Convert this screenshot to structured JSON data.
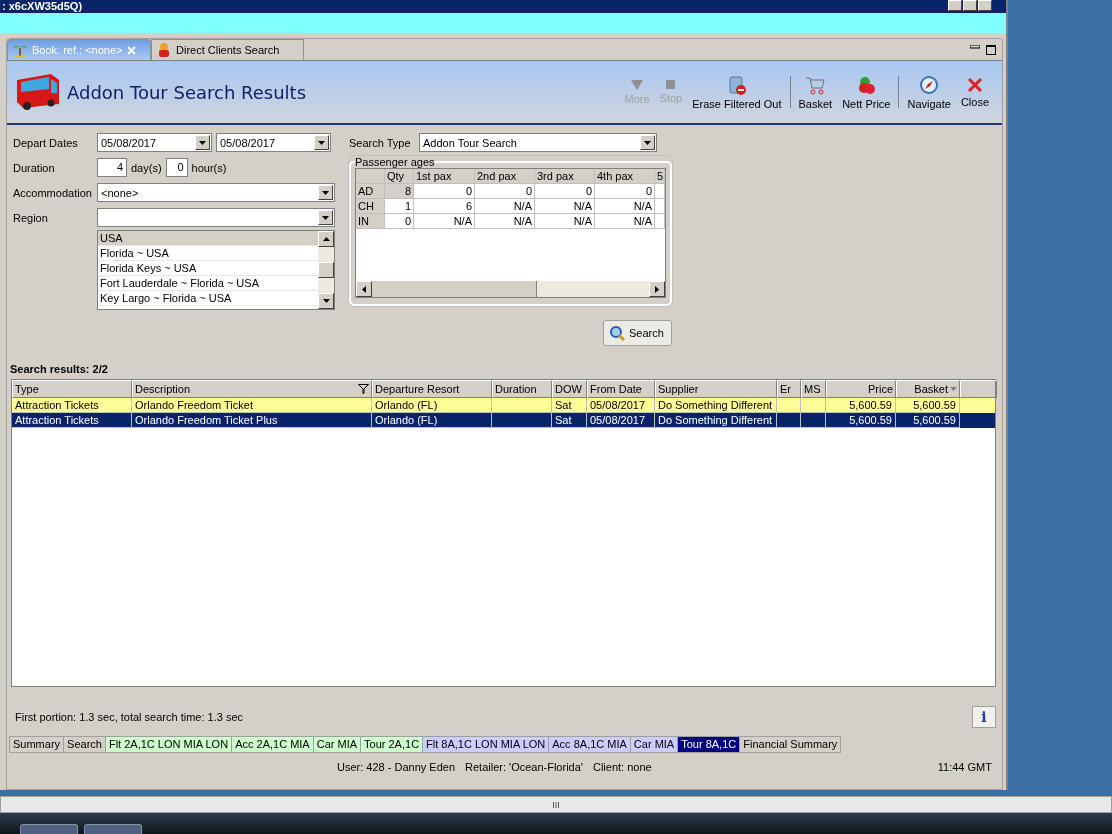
{
  "window": {
    "title": ": x6cXW35d5Q)"
  },
  "doc_tabs": [
    {
      "label": "Book. ref.: <none>",
      "selected": true,
      "closable": true
    },
    {
      "label": "Direct Clients Search",
      "selected": false,
      "closable": false
    }
  ],
  "header": {
    "title": "Addon Tour Search Results"
  },
  "toolbar": [
    {
      "label": "More",
      "disabled": true,
      "kind": "more",
      "separated": false
    },
    {
      "label": "Stop",
      "disabled": true,
      "kind": "stop",
      "separated": false
    },
    {
      "label": "Erase Filtered Out",
      "disabled": false,
      "kind": "erase",
      "separated": false
    },
    {
      "label": "Basket",
      "disabled": false,
      "kind": "basket",
      "separated": true
    },
    {
      "label": "Nett Price",
      "disabled": false,
      "kind": "price",
      "separated": false
    },
    {
      "label": "Navigate",
      "disabled": false,
      "kind": "navigate",
      "separated": true
    },
    {
      "label": "Close",
      "disabled": false,
      "kind": "close",
      "separated": false
    }
  ],
  "form": {
    "depart_dates_label": "Depart Dates",
    "depart_from": "05/08/2017",
    "depart_to": "05/08/2017",
    "duration_label": "Duration",
    "days": "4",
    "days_unit": "day(s)",
    "hours": "0",
    "hours_unit": "hour(s)",
    "accommodation_label": "Accommodation",
    "accommodation": "<none>",
    "region_label": "Region",
    "region_list": [
      {
        "label": "USA",
        "selected": true
      },
      {
        "label": "Florida ~ USA",
        "selected": false
      },
      {
        "label": "Florida Keys ~ USA",
        "selected": false
      },
      {
        "label": "Fort Lauderdale ~ Florida ~ USA",
        "selected": false
      },
      {
        "label": "Key Largo ~ Florida ~ USA",
        "selected": false
      }
    ],
    "search_type_label": "Search Type",
    "search_type": "Addon Tour Search",
    "passenger_ages": {
      "title": "Passenger ages",
      "columns": [
        "Qty",
        "1st pax",
        "2nd pax",
        "3rd pax",
        "4th pax",
        "5"
      ],
      "rows": [
        {
          "label": "AD",
          "cells": [
            "8",
            "0",
            "0",
            "0",
            "0"
          ]
        },
        {
          "label": "CH",
          "cells": [
            "1",
            "6",
            "N/A",
            "N/A",
            "N/A"
          ]
        },
        {
          "label": "IN",
          "cells": [
            "0",
            "N/A",
            "N/A",
            "N/A",
            "N/A"
          ]
        }
      ]
    },
    "search_button": "Search"
  },
  "results": {
    "summary": "Search results: 2/2",
    "columns": [
      "Type",
      "Description",
      "Departure Resort",
      "Duration",
      "DOW",
      "From Date",
      "Supplier",
      "Er",
      "MS",
      "Price",
      "Basket"
    ],
    "rows": [
      {
        "highlighted": true,
        "selected": false,
        "cells": [
          "Attraction Tickets",
          "Orlando Freedom Ticket",
          "Orlando (FL)",
          "",
          "Sat",
          "05/08/2017",
          "Do Something Different",
          "",
          "",
          "5,600.59",
          "5,600.59"
        ]
      },
      {
        "highlighted": false,
        "selected": true,
        "cells": [
          "Attraction Tickets",
          "Orlando Freedom Ticket Plus",
          "Orlando (FL)",
          "",
          "Sat",
          "05/08/2017",
          "Do Something Different",
          "",
          "",
          "5,600.59",
          "5,600.59"
        ]
      }
    ]
  },
  "timing": "First portion: 1.3 sec, total search time: 1.3 sec",
  "info_button": "i",
  "bottom_tabs": [
    {
      "label": "Summary",
      "selected": false,
      "color": "#d4d0c8"
    },
    {
      "label": "Search",
      "selected": false,
      "color": "#d4d0c8"
    },
    {
      "label": "Flt 2A,1C LON MIA LON",
      "selected": false,
      "color": "#ccffcc"
    },
    {
      "label": "Acc 2A,1C MIA",
      "selected": false,
      "color": "#ccffcc"
    },
    {
      "label": "Car MIA",
      "selected": false,
      "color": "#ccffcc"
    },
    {
      "label": "Tour 2A,1C",
      "selected": false,
      "color": "#ccffcc"
    },
    {
      "label": "Flt 8A,1C LON MIA LON",
      "selected": false,
      "color": "#ccccff"
    },
    {
      "label": "Acc 8A,1C MIA",
      "selected": false,
      "color": "#ccccff"
    },
    {
      "label": "Car MIA",
      "selected": false,
      "color": "#ccccff"
    },
    {
      "label": "Tour 8A,1C",
      "selected": true,
      "color": "#000080"
    },
    {
      "label": "Financial Summary",
      "selected": false,
      "color": "#d4d0c8"
    }
  ],
  "status_bar": {
    "user": "User: 428 - Danny Eden",
    "retailer": "Retailer: 'Ocean-Florida'",
    "client": "Client: none",
    "time": "11:44 GMT"
  },
  "scrollbar_grip": "III"
}
